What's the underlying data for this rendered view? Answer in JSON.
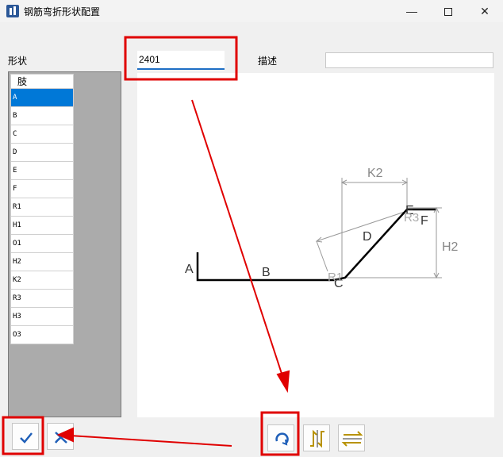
{
  "window": {
    "title": "钢筋弯折形状配置",
    "icon": "app-logo-icon",
    "controls": [
      "minimize-icon",
      "maximize-icon",
      "close-icon"
    ]
  },
  "form": {
    "shape_label": "形状",
    "shape_code_value": "2401",
    "desc_label": "描述",
    "desc_value": ""
  },
  "legs": {
    "header": "肢",
    "items": [
      "A",
      "B",
      "C",
      "D",
      "E",
      "F",
      "R1",
      "H1",
      "O1",
      "H2",
      "K2",
      "R3",
      "H3",
      "O3"
    ],
    "selected": "A"
  },
  "drawing": {
    "labels": {
      "A": "A",
      "B": "B",
      "C": "C",
      "D": "D",
      "E": "E",
      "F": "F",
      "R1": "R1",
      "R3": "R3",
      "K2": "K2",
      "H2": "H2"
    },
    "colors": {
      "bar": "#000000",
      "dimension": "#999999",
      "annotation": "#e00000"
    }
  },
  "buttons": {
    "ok": "checkmark-icon",
    "cancel": "cancel-icon",
    "rotate": "rotate-icon",
    "mirror_h": "mirror-horizontal-icon",
    "mirror_v": "mirror-vertical-icon"
  }
}
